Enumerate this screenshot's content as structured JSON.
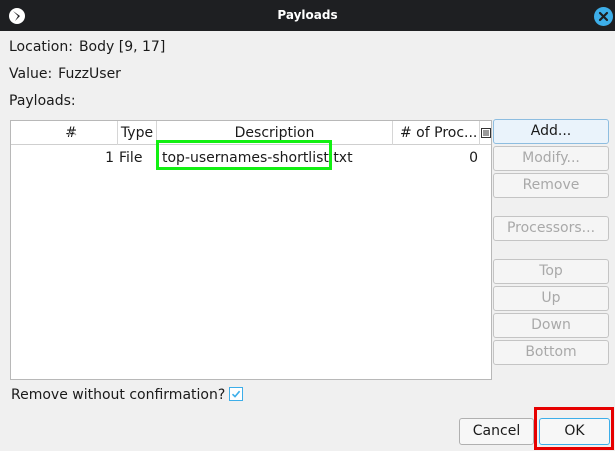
{
  "window": {
    "title": "Payloads",
    "close_icon": "close-icon"
  },
  "info": {
    "location_label": "Location:",
    "location_value": "Body [9, 17]",
    "value_label": "Value:",
    "value_value": "FuzzUser",
    "payloads_label": "Payloads:"
  },
  "table": {
    "columns": [
      "#",
      "Type",
      "Description",
      "# of Proc..."
    ],
    "sort_indicator": "^",
    "rows": [
      {
        "num": "1",
        "type": "File",
        "description": "top-usernames-shortlist.txt",
        "processors": "0"
      }
    ]
  },
  "side_buttons": {
    "add": "Add...",
    "modify": "Modify...",
    "remove": "Remove",
    "processors": "Processors...",
    "top": "Top",
    "up": "Up",
    "down": "Down",
    "bottom": "Bottom"
  },
  "options": {
    "remove_confirm_label": "Remove without confirmation?",
    "remove_confirm_checked": true
  },
  "footer": {
    "cancel": "Cancel",
    "ok": "OK"
  },
  "colors": {
    "titlebar": "#1e1f22",
    "accent": "#3daee9",
    "highlight_green": "#12f012",
    "highlight_red": "#e60000"
  }
}
